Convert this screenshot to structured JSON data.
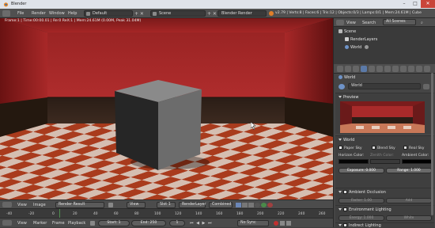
{
  "window": {
    "title": "Blender",
    "minimize": "–",
    "maximize": "□",
    "close": "✕"
  },
  "menu": [
    "File",
    "Render",
    "Window",
    "Help"
  ],
  "layout_selector": "Default",
  "scene_selector": "Scene",
  "engine_selector": "Blender Render",
  "stats": "v2.79 | Verts:8 | Faces:6 | Tris:12 | Objects:0/3 | Lamps:0/1 | Mem:24.61M | Cube",
  "viewport_info": "Frame:1 | Time:00:00.01 | Re:0 ReX:1 | Mem:24.61M (0.00M, Peak 31.04M)",
  "image_editor": {
    "view": "View",
    "image": "Image",
    "result": "Render Result",
    "view2": "View",
    "slot": "Slot 1",
    "layer": "RenderLayer",
    "pass": "Combined"
  },
  "timeline": {
    "ticks": [
      "-40",
      "-20",
      "0",
      "20",
      "40",
      "60",
      "80",
      "100",
      "120",
      "140",
      "160",
      "180",
      "200",
      "220",
      "240",
      "260"
    ],
    "menu": [
      "View",
      "Marker",
      "Frame",
      "Playback"
    ],
    "start": "Start:",
    "start_val": "1",
    "end": "End:",
    "end_val": "250",
    "current": "1",
    "sync": "No Sync"
  },
  "outliner": {
    "view": "View",
    "search": "Search",
    "filter": "All Scenes",
    "items": [
      "Scene",
      "RenderLayers",
      "World"
    ]
  },
  "properties": {
    "world_tab": "World",
    "world_field": "World",
    "preview": "Preview",
    "world_panel": "World",
    "paper_sky": "Paper Sky",
    "blend_sky": "Blend Sky",
    "real_sky": "Real Sky",
    "horizon_color": "Horizon Color:",
    "zenith_color": "Zenith Color:",
    "ambient_color": "Ambient Color:",
    "exposure": "Exposure:",
    "exposure_val": "0.000",
    "range": "Range:",
    "range_val": "1.000",
    "ambient_occlusion": "Ambient Occlusion",
    "factor": "Factor:",
    "factor_val": "1.00",
    "add": "Add",
    "environment_lighting": "Environment Lighting",
    "energy": "Energy:",
    "energy_val": "1.000",
    "white": "White",
    "indirect_lighting": "Indirect Lighting"
  },
  "colors": {
    "horizon": "#050505",
    "ambient": "#000000",
    "accent": "#5b7aa8"
  }
}
